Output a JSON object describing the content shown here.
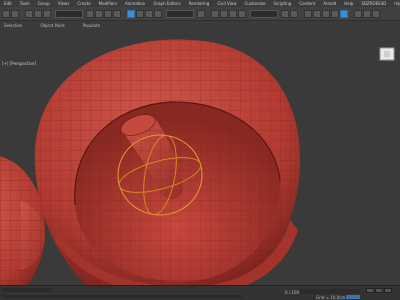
{
  "menu": {
    "items": [
      "Edit",
      "Tools",
      "Group",
      "Views",
      "Create",
      "Modifiers",
      "Animation",
      "Graph Editors",
      "Rendering",
      "Civil View",
      "Customize",
      "Scripting",
      "Content",
      "Arnold",
      "Help",
      "SDZROEE4D",
      "mjulTools"
    ]
  },
  "viewport": {
    "label": "[+] [Perspective]",
    "colors": {
      "mesh": "#c0443a",
      "mesh_dark": "#8a2a24",
      "wire": "#6a1a16",
      "gizmo": "#e0a030",
      "background": "#3a3a3a"
    }
  },
  "ribbon": {
    "items": [
      "Selection",
      "Object Paint",
      "Populate"
    ]
  },
  "status": {
    "time": "0 / 100",
    "grid": "Grid = 10.0cm",
    "key": "Add Time Tag"
  }
}
